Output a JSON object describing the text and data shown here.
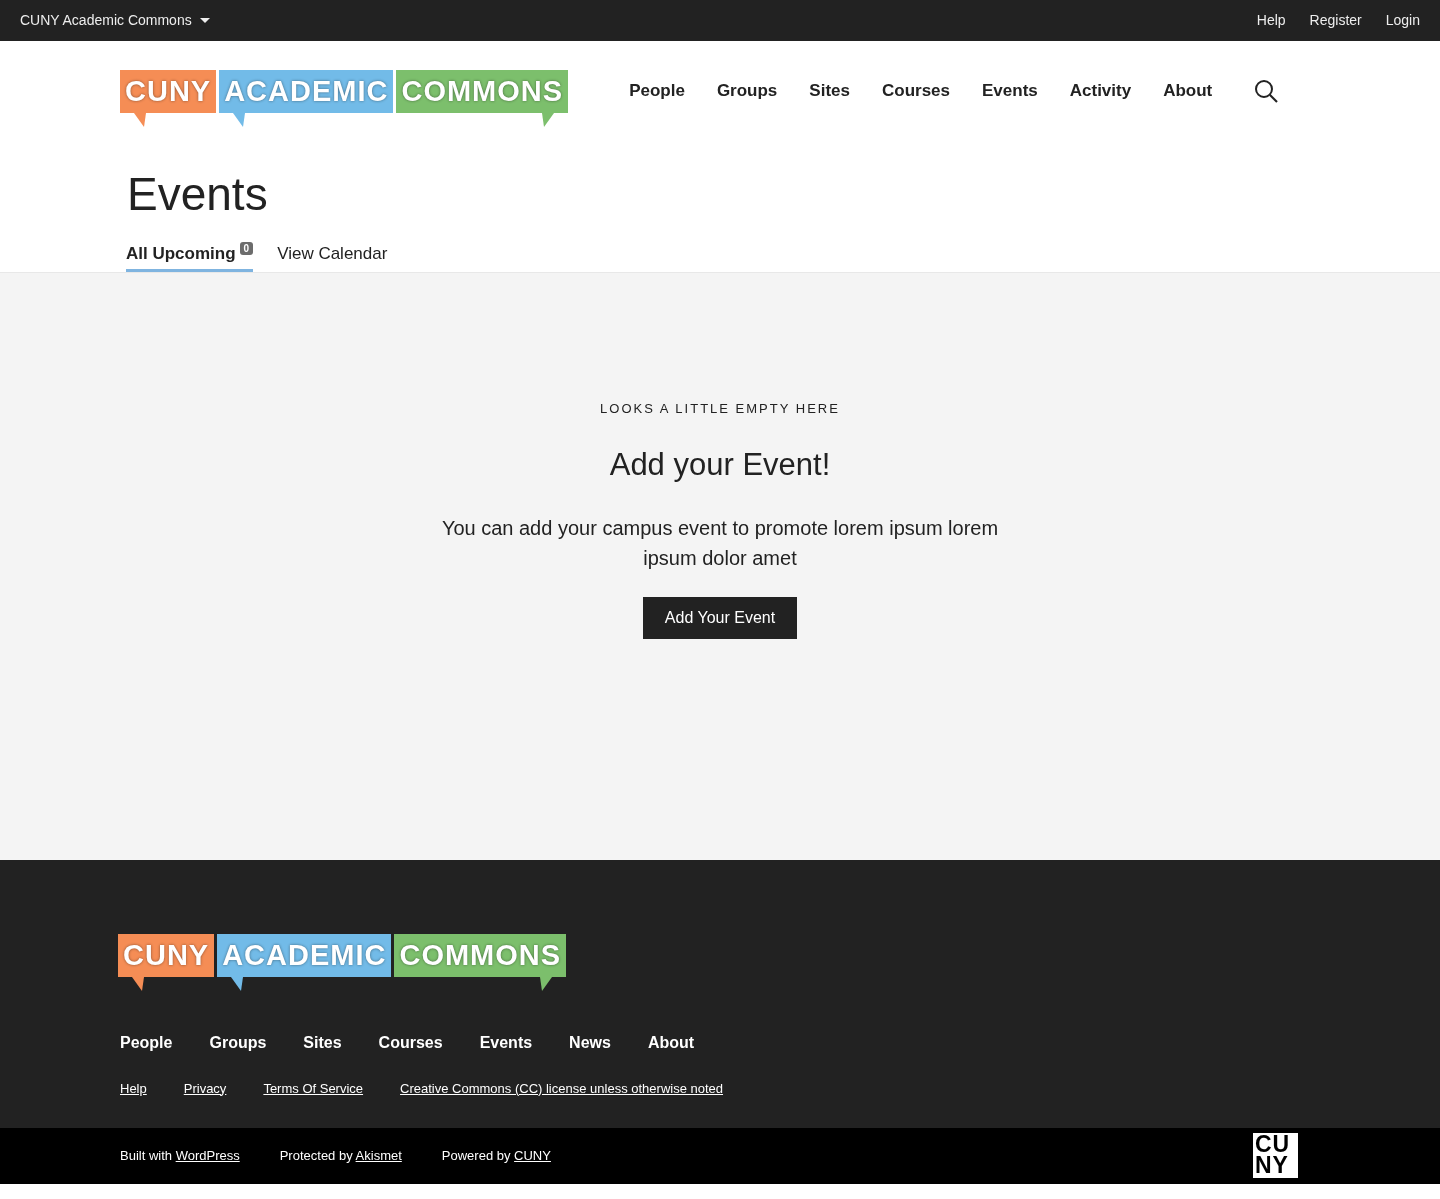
{
  "top_bar": {
    "site_menu": "CUNY Academic Commons",
    "links": [
      "Help",
      "Register",
      "Login"
    ]
  },
  "header": {
    "logo": [
      {
        "text": "CUNY",
        "color": "#f58d55"
      },
      {
        "text": "ACADEMIC",
        "color": "#72bbe8"
      },
      {
        "text": "COMMONS",
        "color": "#7cbf6c"
      }
    ],
    "nav": [
      "People",
      "Groups",
      "Sites",
      "Courses",
      "Events",
      "Activity",
      "About"
    ]
  },
  "page": {
    "title": "Events",
    "tabs": [
      {
        "label": "All Upcoming",
        "count": "0",
        "selected": true
      },
      {
        "label": "View Calendar",
        "selected": false
      }
    ]
  },
  "empty_state": {
    "eyebrow": "LOOKS A LITTLE EMPTY HERE",
    "heading": "Add your Event!",
    "body": "You can add your campus event to promote lorem ipsum lorem ipsum dolor amet",
    "button": "Add Your Event"
  },
  "footer": {
    "logo": [
      {
        "text": "CUNY",
        "color": "#f58d55"
      },
      {
        "text": "ACADEMIC",
        "color": "#72bbe8"
      },
      {
        "text": "COMMONS",
        "color": "#7cbf6c"
      }
    ],
    "nav": [
      "People",
      "Groups",
      "Sites",
      "Courses",
      "Events",
      "News",
      "About"
    ],
    "links": [
      "Help",
      "Privacy",
      "Terms Of Service",
      "Creative Commons (CC) license unless otherwise noted"
    ],
    "credits": [
      {
        "prefix": "Built with",
        "link": "WordPress"
      },
      {
        "prefix": "Protected by",
        "link": "Akismet"
      },
      {
        "prefix": "Powered by",
        "link": "CUNY"
      }
    ],
    "cuny_mark": [
      "CU",
      "NY"
    ]
  }
}
